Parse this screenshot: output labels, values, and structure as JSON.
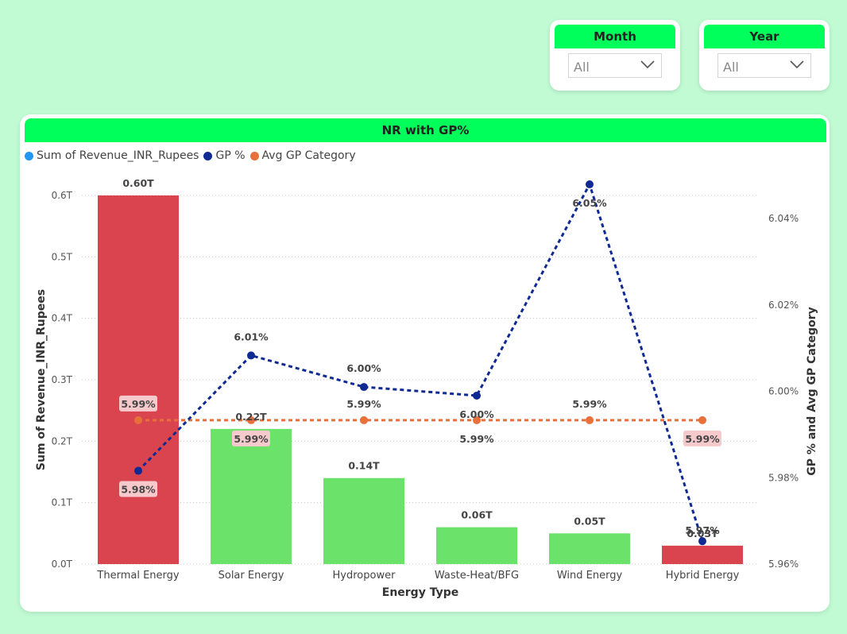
{
  "slicers": {
    "month": {
      "title": "Month",
      "value": "All"
    },
    "year": {
      "title": "Year",
      "value": "All"
    }
  },
  "visual": {
    "title": "NR with GP%"
  },
  "colors": {
    "page_bg": "#c1fbd3",
    "header_green": "#00ff5a",
    "bar_red": "#d9444e",
    "bar_green": "#6be26a",
    "revenue_legend": "#2196f3",
    "gp_line": "#102a94",
    "avg_line": "#e8703a"
  },
  "chart_data": {
    "type": "bar",
    "categories": [
      "Thermal Energy",
      "Solar Energy",
      "Hydropower",
      "Waste-Heat/BFG",
      "Wind Energy",
      "Hybrid Energy"
    ],
    "series": [
      {
        "name": "Sum of Revenue_INR_Rupees",
        "type": "bar",
        "axis": "left",
        "values": [
          0.6,
          0.22,
          0.14,
          0.06,
          0.05,
          0.03
        ],
        "labels": [
          "0.60T",
          "0.22T",
          "0.14T",
          "0.06T",
          "0.05T",
          "0.03T"
        ],
        "bar_colors": [
          "#d9444e",
          "#6be26a",
          "#6be26a",
          "#6be26a",
          "#6be26a",
          "#d9444e"
        ]
      },
      {
        "name": "GP %",
        "type": "line",
        "axis": "right",
        "values": [
          5.9816,
          6.0083,
          6.001,
          5.999,
          6.0479,
          5.9653
        ],
        "labels": [
          "5.98%",
          "6.01%",
          "6.00%",
          "6.00%",
          "6.05%",
          "5.97%"
        ]
      },
      {
        "name": "Avg GP Category",
        "type": "line",
        "axis": "right",
        "values": [
          5.9933,
          5.9933,
          5.9933,
          5.9933,
          5.9933,
          5.9933
        ],
        "labels": [
          "5.99%",
          "5.99%",
          "5.99%",
          "5.99%",
          "5.99%",
          "5.99%"
        ]
      }
    ],
    "xlabel": "Energy Type",
    "ylabel": "Sum of Revenue_INR_Rupees",
    "y2label": "GP % and Avg GP Category",
    "ylim": [
      0,
      0.6
    ],
    "yticks": [
      "0.0T",
      "0.1T",
      "0.2T",
      "0.3T",
      "0.4T",
      "0.5T",
      "0.6T"
    ],
    "y2lim": [
      5.96,
      6.04
    ],
    "y2ticks": [
      "5.96%",
      "5.98%",
      "6.00%",
      "6.02%",
      "6.04%"
    ],
    "legend_position": "top-left",
    "grid": true
  }
}
